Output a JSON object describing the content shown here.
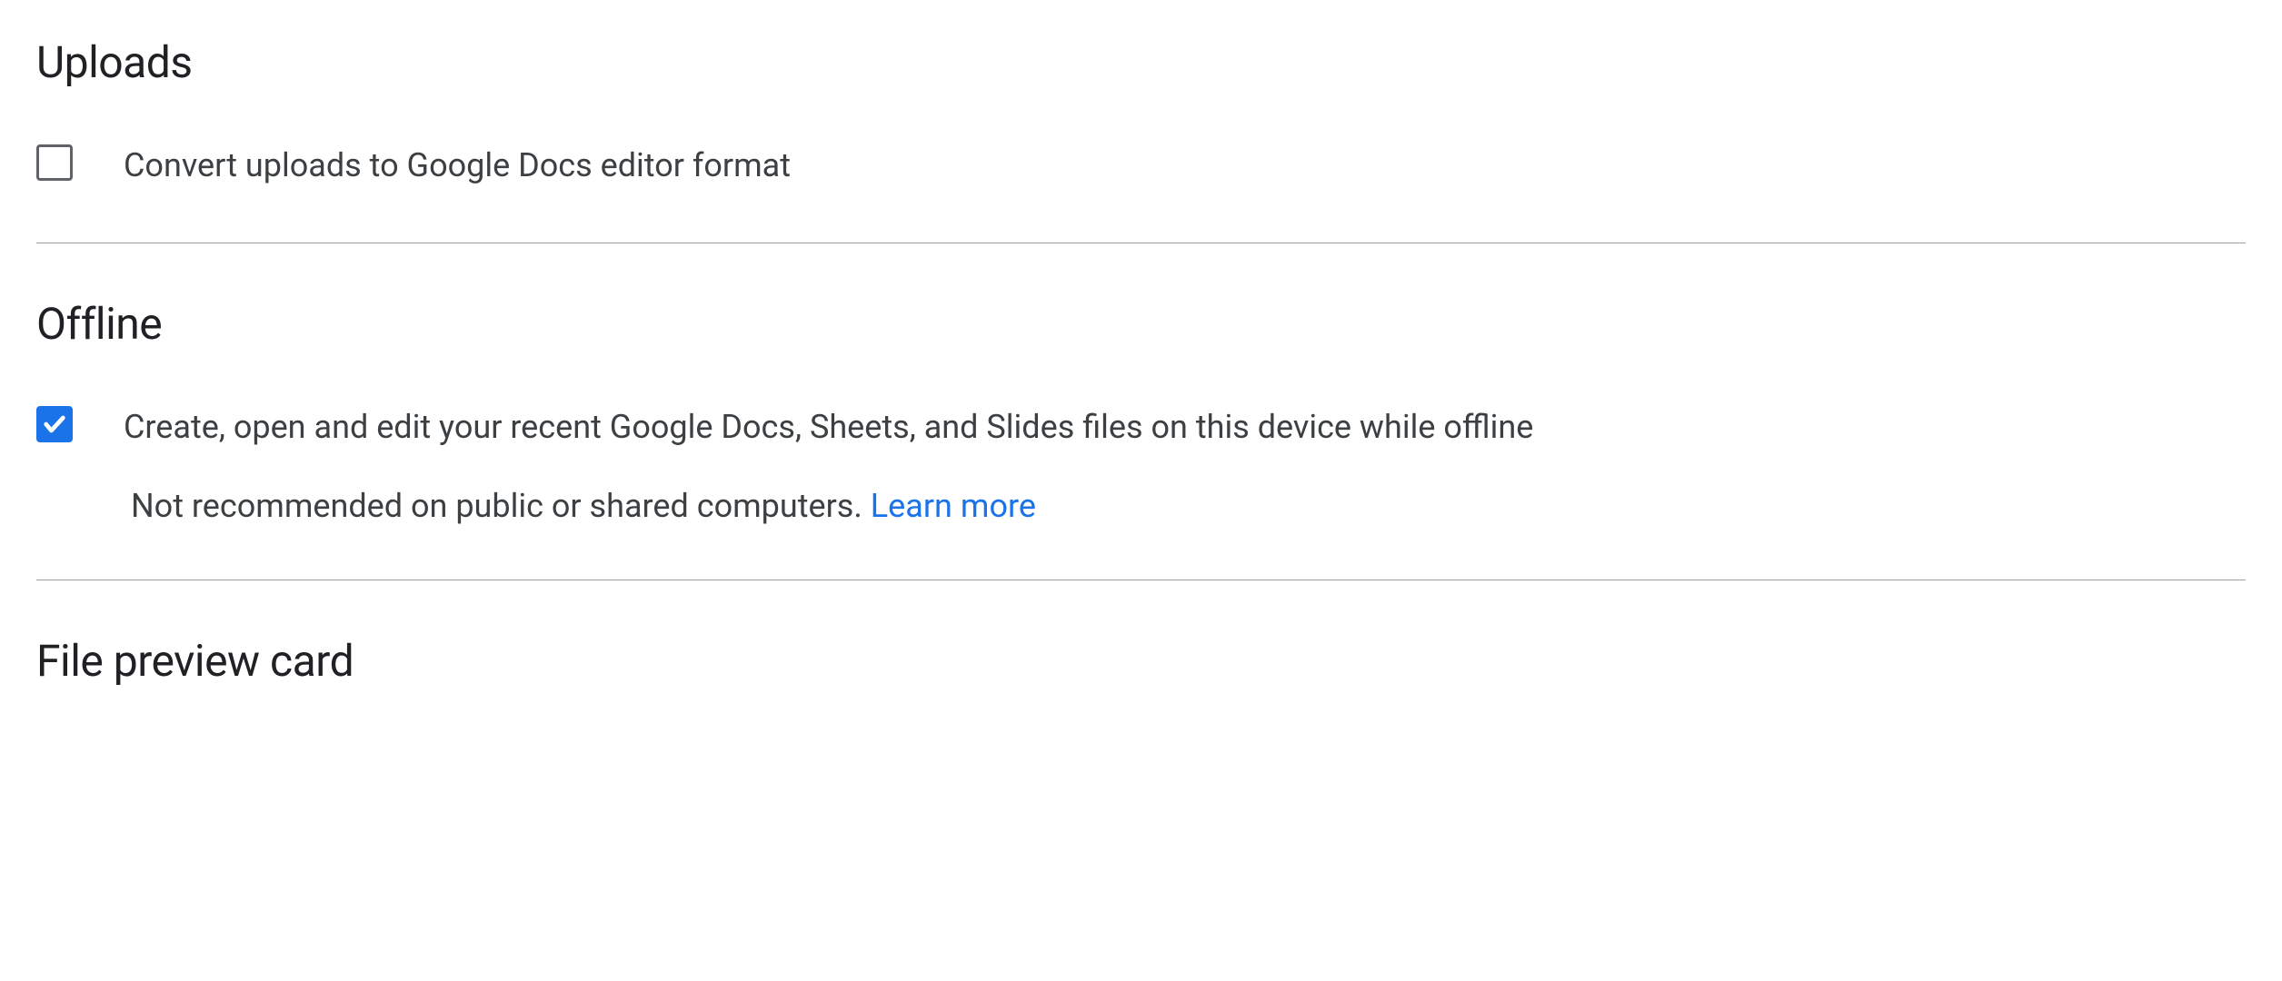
{
  "sections": {
    "uploads": {
      "title": "Uploads",
      "option": {
        "label": "Convert uploads to Google Docs editor format",
        "checked": false
      }
    },
    "offline": {
      "title": "Offline",
      "option": {
        "label": "Create, open and edit your recent Google Docs, Sheets, and Slides files on this device while offline",
        "subtext": "Not recommended on public or shared computers. ",
        "link_text": "Learn more",
        "checked": true
      }
    },
    "file_preview": {
      "title": "File preview card"
    }
  }
}
